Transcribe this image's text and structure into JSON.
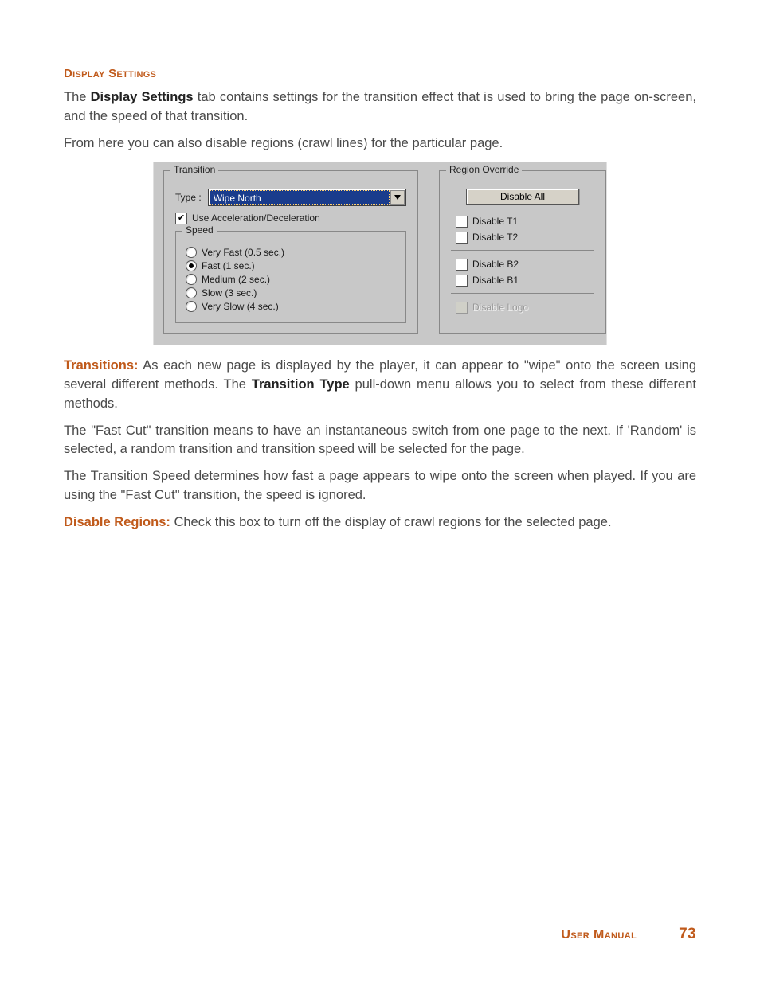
{
  "heading": "Display Settings",
  "paras": {
    "p1a": "The ",
    "p1b": "Display Settings",
    "p1c": " tab contains settings for the transition effect that is used to bring the page on-screen, and the speed of that transition.",
    "p2": "From here you can also disable regions (crawl lines) for the particular page.",
    "p3a": "Transitions:",
    "p3b": " As each new page is displayed by the player, it can appear to \"wipe\" onto the screen using several different methods. The ",
    "p3c": "Transition Type",
    "p3d": " pull-down menu allows you to select from these different methods.",
    "p4": "The \"Fast Cut\" transition means to have an instantaneous switch from one page to the next. If 'Random' is selected, a random transition and transition speed will be selected for the page.",
    "p5": "The Transition Speed determines how fast a page appears to wipe onto the screen when played. If you are using the \"Fast Cut\" transition, the speed is ignored.",
    "p6a": "Disable Regions:",
    "p6b": " Check this box to turn off the display of crawl regions for the selected page."
  },
  "dialog": {
    "transition": {
      "title": "Transition",
      "typeLabel": "Type :",
      "typeValue": "Wipe North",
      "accel": {
        "label": "Use Acceleration/Deceleration",
        "checked": true
      },
      "speed": {
        "title": "Speed",
        "options": [
          {
            "label": "Very Fast (0.5 sec.)",
            "selected": false
          },
          {
            "label": "Fast (1 sec.)",
            "selected": true
          },
          {
            "label": "Medium (2 sec.)",
            "selected": false
          },
          {
            "label": "Slow (3 sec.)",
            "selected": false
          },
          {
            "label": "Very Slow (4 sec.)",
            "selected": false
          }
        ]
      }
    },
    "region": {
      "title": "Region Override",
      "disableAll": "Disable All",
      "items1": [
        {
          "label": "Disable T1",
          "checked": false
        },
        {
          "label": "Disable T2",
          "checked": false
        }
      ],
      "items2": [
        {
          "label": "Disable B2",
          "checked": false
        },
        {
          "label": "Disable B1",
          "checked": false
        }
      ],
      "logo": {
        "label": "Disable Logo",
        "checked": false,
        "disabled": true
      }
    }
  },
  "footer": {
    "label": "User Manual",
    "page": "73"
  }
}
